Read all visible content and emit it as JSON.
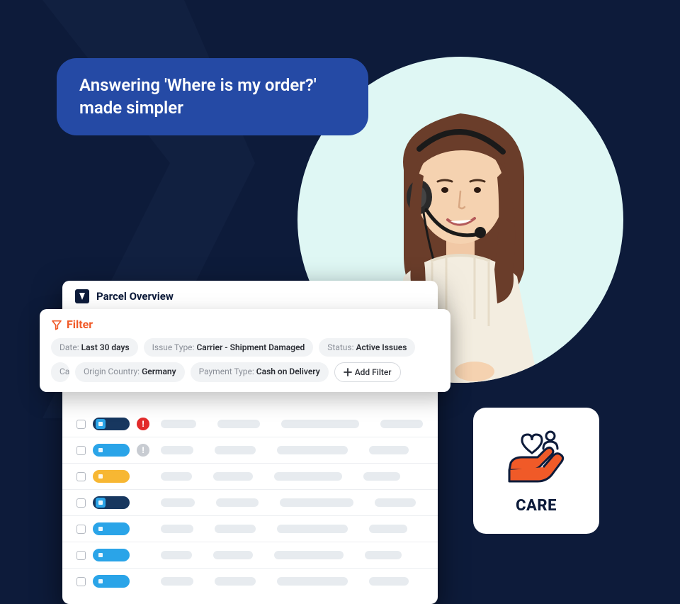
{
  "headline": "Answering 'Where is my order?' made simpler",
  "panel": {
    "title": "Parcel Overview"
  },
  "filter": {
    "label": "Filter",
    "chips": [
      {
        "key": "Date",
        "value": "Last 30 days"
      },
      {
        "key": "Issue Type",
        "value": "Carrier - Shipment Damaged"
      },
      {
        "key": "Status",
        "value": "Active Issues"
      },
      {
        "key": "Origin Country",
        "value": "Germany"
      },
      {
        "key": "Payment Type",
        "value": "Cash on Delivery"
      }
    ],
    "add_label": "Add Filter"
  },
  "rows": [
    {
      "badge_bg": "#17375f",
      "icon_bg": "#2aa4e8",
      "alert": "danger"
    },
    {
      "badge_bg": "#2aa4e8",
      "icon_bg": "#2aa4e8",
      "alert": "muted"
    },
    {
      "badge_bg": "#f7b733",
      "icon_bg": "#f7b733",
      "alert": null
    },
    {
      "badge_bg": "#17375f",
      "icon_bg": "#2aa4e8",
      "alert": null
    },
    {
      "badge_bg": "#2aa4e8",
      "icon_bg": "#2aa4e8",
      "alert": null
    },
    {
      "badge_bg": "#2aa4e8",
      "icon_bg": "#2aa4e8",
      "alert": null
    },
    {
      "badge_bg": "#2aa4e8",
      "icon_bg": "#2aa4e8",
      "alert": null
    }
  ],
  "care": {
    "label": "CARE"
  },
  "colors": {
    "accent": "#f05a28",
    "navy": "#0d1b3a",
    "danger": "#e22b2b",
    "muted": "#c8ccd2"
  }
}
